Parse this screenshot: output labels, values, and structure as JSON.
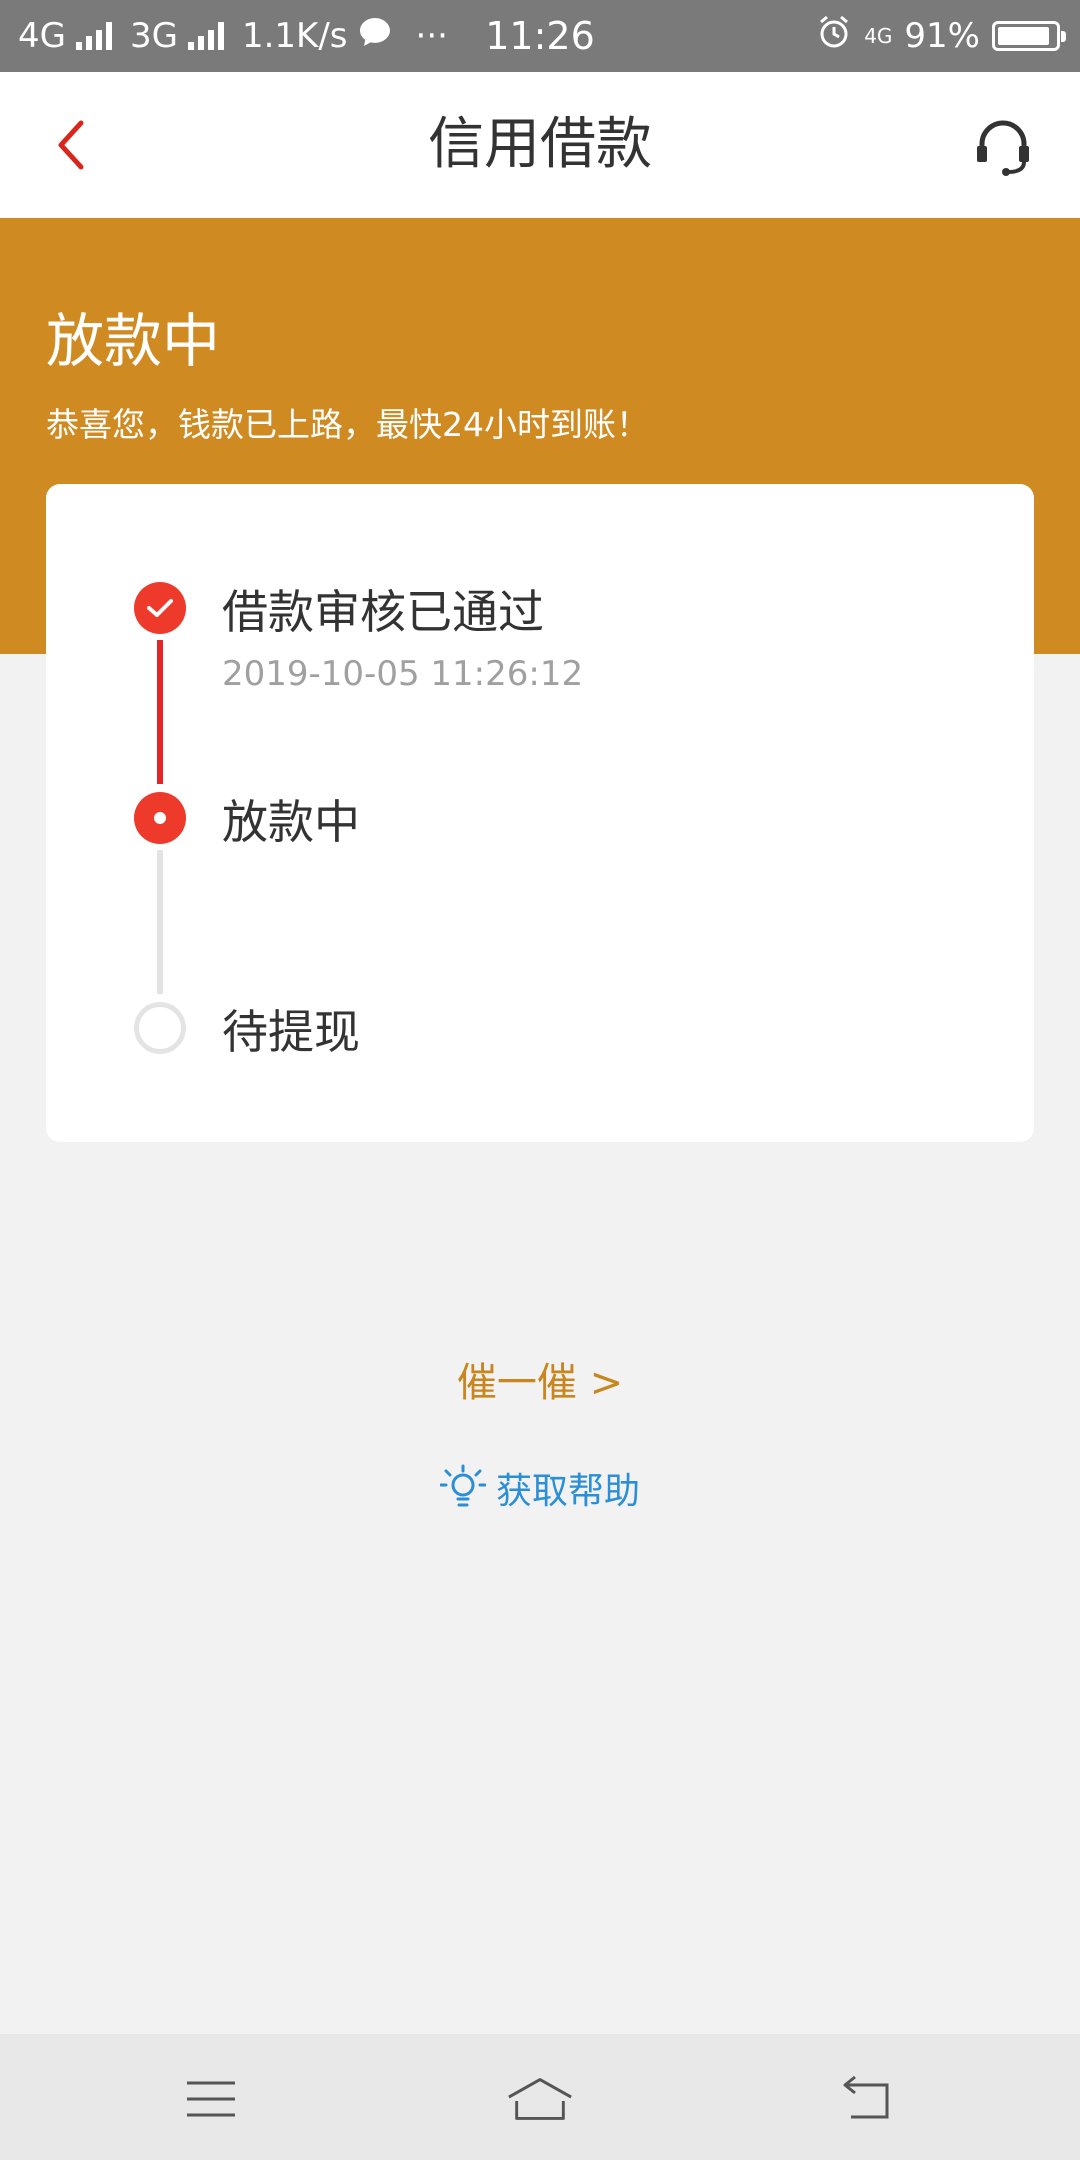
{
  "status_bar": {
    "network1": "4G",
    "network2": "3G",
    "speed": "1.1K/s",
    "more": "···",
    "time": "11:26",
    "network_small": "4G",
    "battery": "91%",
    "battery_level": 0.91
  },
  "nav": {
    "title": "信用借款"
  },
  "hero": {
    "title": "放款中",
    "subtitle": "恭喜您，钱款已上路，最快24小时到账！"
  },
  "steps": [
    {
      "label": "借款审核已通过",
      "time": "2019-10-05 11:26:12",
      "state": "done"
    },
    {
      "label": "放款中",
      "time": "",
      "state": "active"
    },
    {
      "label": "待提现",
      "time": "",
      "state": "pending"
    }
  ],
  "actions": {
    "urge": "催一催 >",
    "help": "获取帮助"
  },
  "colors": {
    "accent_orange": "#d08a22",
    "step_red": "#ee3a2a",
    "help_blue": "#2a8fd6"
  },
  "icons": {
    "back": "chevron-left-icon",
    "customer_service": "headset-icon",
    "help": "lightbulb-icon",
    "menu": "menu-icon",
    "home": "home-icon",
    "return": "return-icon"
  }
}
